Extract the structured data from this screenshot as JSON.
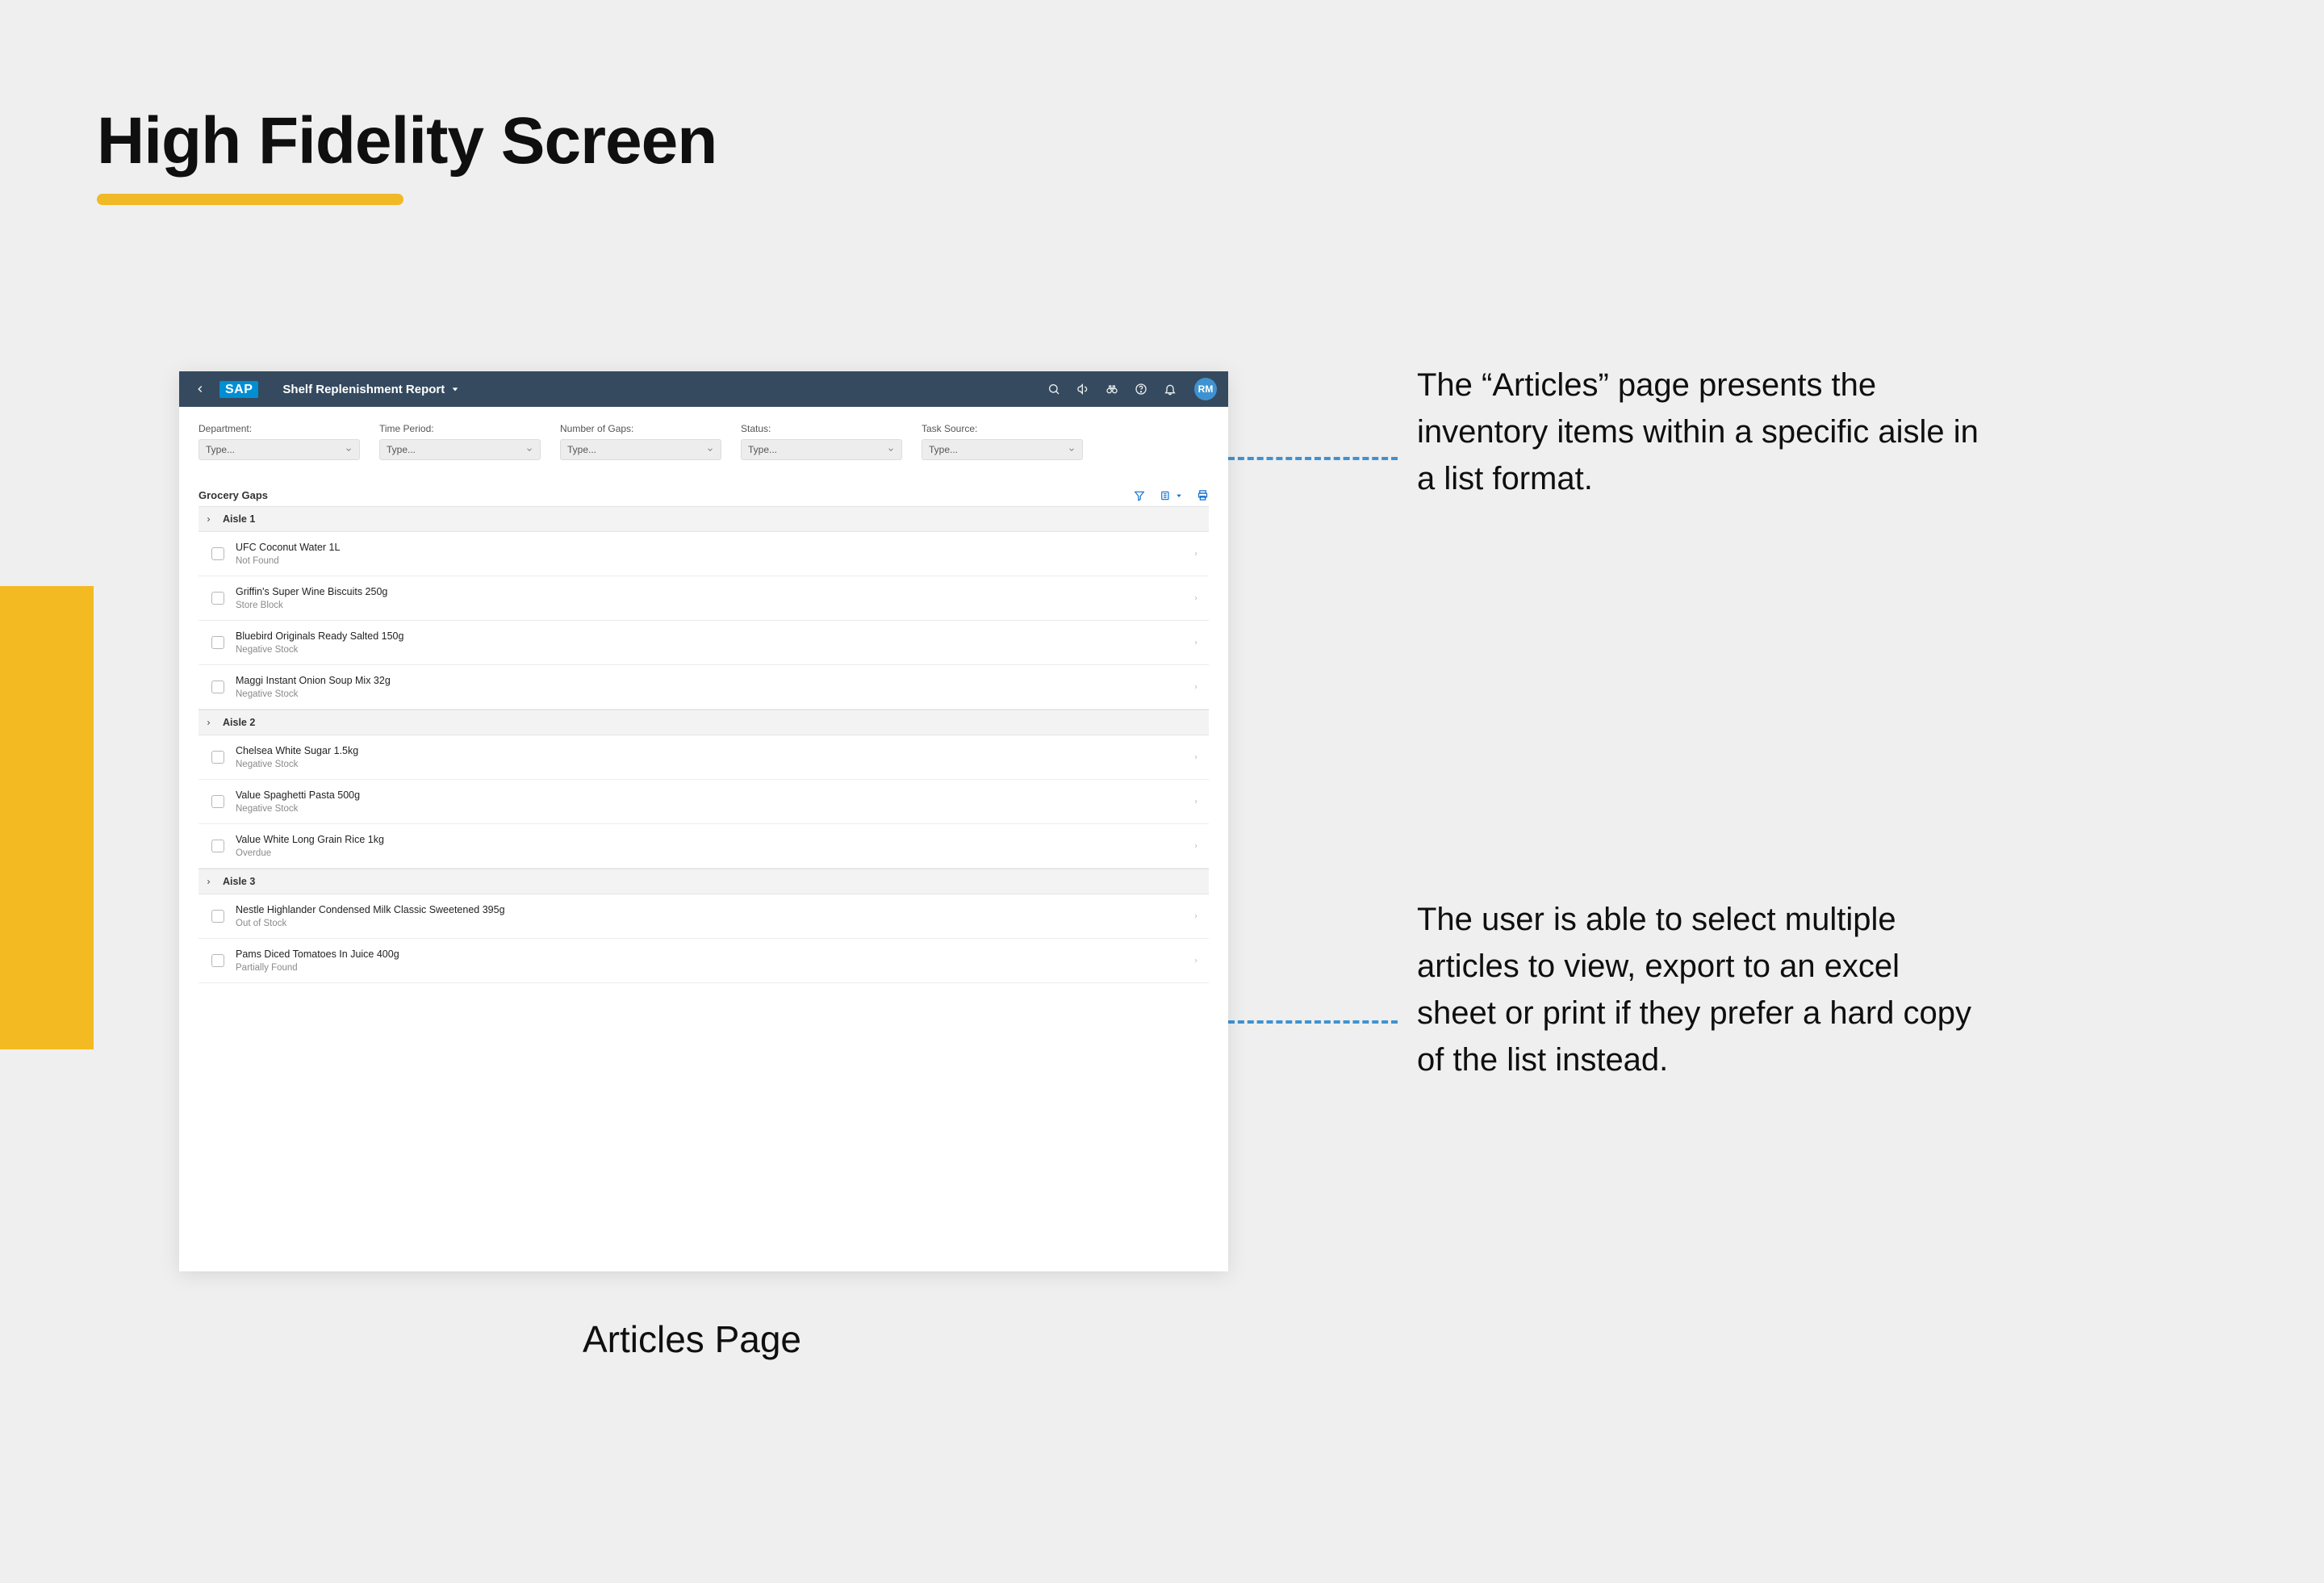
{
  "page": {
    "heading": "High Fidelity Screen",
    "caption": "Articles Page"
  },
  "annotations": {
    "a1": "The “Articles” page presents the inventory items within a specific aisle in a list format.",
    "a2": "The user is able to select multiple articles to view, export to an excel sheet or print if they prefer a hard copy of the list instead."
  },
  "app": {
    "logo_text": "SAP",
    "title": "Shelf Replenishment Report",
    "avatar": "RM",
    "filters": [
      {
        "label": "Department:",
        "value": "Type..."
      },
      {
        "label": "Time Period:",
        "value": "Type..."
      },
      {
        "label": "Number of Gaps:",
        "value": "Type..."
      },
      {
        "label": "Status:",
        "value": "Type..."
      },
      {
        "label": "Task Source:",
        "value": "Type..."
      }
    ],
    "section_title": "Grocery Gaps",
    "groups": [
      {
        "name": "Aisle 1",
        "items": [
          {
            "title": "UFC Coconut Water 1L",
            "status": "Not Found"
          },
          {
            "title": "Griffin's Super Wine Biscuits 250g",
            "status": "Store Block"
          },
          {
            "title": "Bluebird Originals Ready Salted 150g",
            "status": "Negative Stock"
          },
          {
            "title": "Maggi Instant Onion Soup Mix 32g",
            "status": "Negative Stock"
          }
        ]
      },
      {
        "name": "Aisle 2",
        "items": [
          {
            "title": "Chelsea White Sugar 1.5kg",
            "status": "Negative Stock"
          },
          {
            "title": "Value Spaghetti Pasta 500g",
            "status": "Negative Stock"
          },
          {
            "title": "Value White Long Grain Rice 1kg",
            "status": "Overdue"
          }
        ]
      },
      {
        "name": "Aisle 3",
        "items": [
          {
            "title": "Nestle Highlander Condensed Milk Classic Sweetened 395g",
            "status": "Out of Stock"
          },
          {
            "title": "Pams Diced Tomatoes In Juice 400g",
            "status": "Partially Found"
          }
        ]
      }
    ]
  }
}
